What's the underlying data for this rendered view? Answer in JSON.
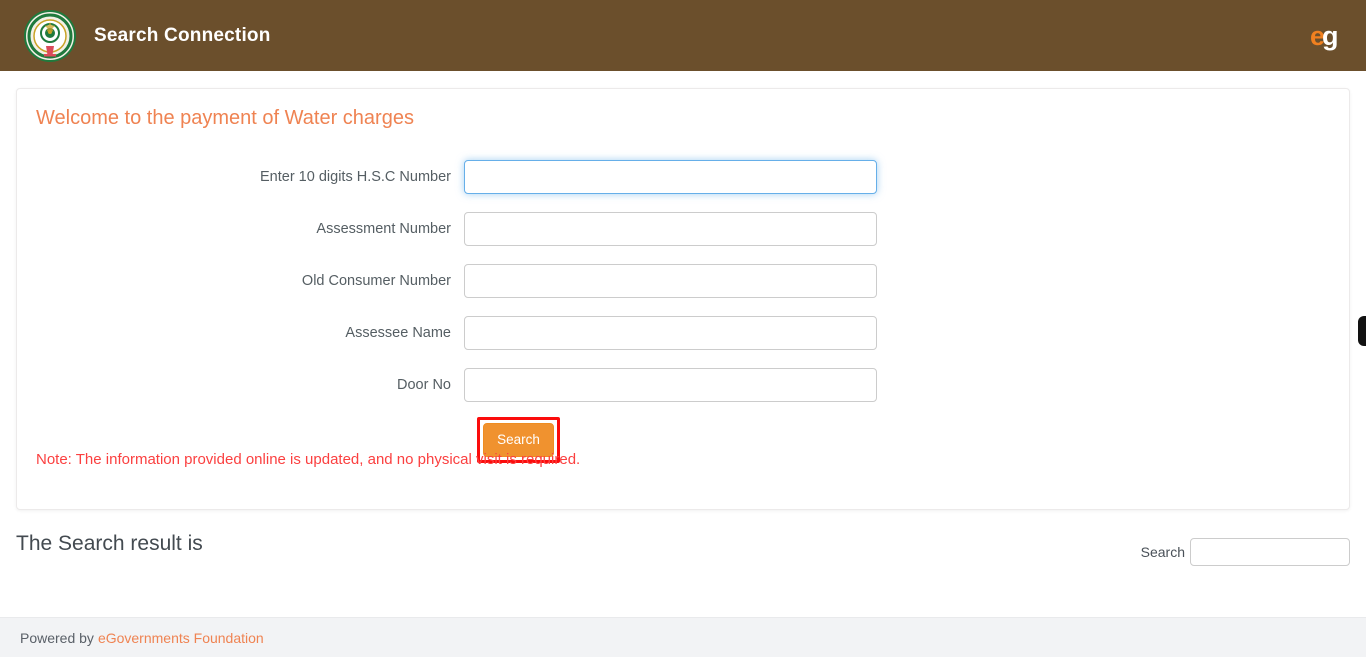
{
  "header": {
    "title": "Search Connection",
    "emblem_icon": "ap-government-emblem-icon",
    "brand_icon": "egov-logo-icon",
    "brand_e": "e",
    "brand_g": "g",
    "background_color": "#6b4f2c"
  },
  "card": {
    "title": "Welcome to the payment of Water charges",
    "title_color": "#ef8352",
    "note": "Note: The information provided online is updated, and no physical visit is required.",
    "note_color": "#fb4040"
  },
  "form": {
    "fields": [
      {
        "label": "Enter 10 digits H.S.C Number",
        "value": "",
        "placeholder": "",
        "focused": true
      },
      {
        "label": "Assessment Number",
        "value": "",
        "placeholder": "",
        "focused": false
      },
      {
        "label": "Old Consumer Number",
        "value": "",
        "placeholder": "",
        "focused": false
      },
      {
        "label": "Assessee Name",
        "value": "",
        "placeholder": "",
        "focused": false
      },
      {
        "label": "Door No",
        "value": "",
        "placeholder": "",
        "focused": false
      }
    ],
    "submit_label": "Search",
    "submit_color": "#f0922f",
    "highlight_color": "#fb0c0c"
  },
  "results": {
    "title": "The Search result is",
    "search_label": "Search",
    "search_value": "",
    "search_placeholder": ""
  },
  "footer": {
    "powered_by": "Powered by",
    "link": "eGovernments Foundation",
    "link_color": "#ef8352"
  }
}
